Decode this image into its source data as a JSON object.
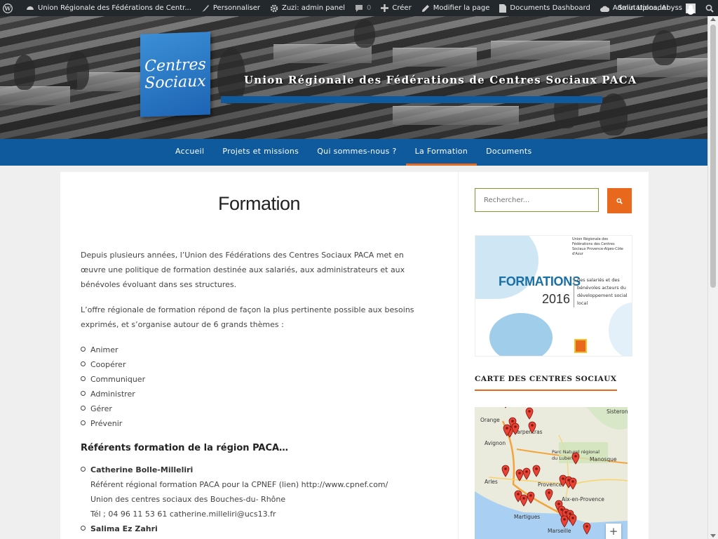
{
  "admin_bar": {
    "items": [
      {
        "name": "site-link",
        "label": "Union Régionale des Fédérations de Centr..."
      },
      {
        "name": "customize-link",
        "label": "Personnaliser"
      },
      {
        "name": "admin-panel-link",
        "label": "Zuzi: admin panel"
      },
      {
        "name": "comments-link",
        "label": "0"
      },
      {
        "name": "new-content-link",
        "label": "Créer"
      },
      {
        "name": "edit-page-link",
        "label": "Modifier la page"
      },
      {
        "name": "documents-dashboard-link",
        "label": "Documents Dashboard"
      },
      {
        "name": "admin-uploader-link",
        "label": "Admin Uploader"
      }
    ],
    "greeting": "Salutations, Abyss"
  },
  "header": {
    "logo_text": "Centres Sociaux",
    "site_title": "Union Régionale des Fédérations de Centres Sociaux PACA"
  },
  "nav": {
    "items": [
      "Accueil",
      "Projets et missions",
      "Qui sommes-nous ?",
      "La Formation",
      "Documents"
    ],
    "active": "La Formation"
  },
  "main": {
    "title": "Formation",
    "intro": "Depuis plusieurs années, l’Union des Fédérations des Centres Sociaux PACA met en œuvre une politique de formation destinée aux salariés, aux administrateurs et aux bénévoles évoluant dans ses structures.",
    "intro2": "L’offre régionale de formation répond de façon la plus pertinente possible aux besoins exprimés, et s’organise autour de 6 grands thèmes :",
    "themes": [
      "Animer",
      "Coopérer",
      "Communiquer",
      "Administrer",
      "Gérer",
      "Prévenir"
    ],
    "referents_heading": "Référents formation de la région PACA…",
    "referents": [
      {
        "name": "Catherine Bolle-Milleliri",
        "line1": "Référent régional formation PACA pour la CPNEF (lien) http://www.cpnef.com/",
        "line2": "Union des centres sociaux des Bouches-du- Rhône",
        "line3": "Tél ; 04 96 11 53 61 catherine.milleliri@ucs13.fr"
      },
      {
        "name": "Salima Ez Zahri"
      }
    ]
  },
  "sidebar": {
    "search_placeholder": "Rechercher...",
    "promo": {
      "org": "Union Régionale des Fédérations des Centres Sociaux Provence-Alpes-Côte d'Azur",
      "big": "FORMATIONS",
      "year": "2016",
      "desc": "des salariés et des bénévoles acteurs du développement social local"
    },
    "map_title": "CARTE DES CENTRES SOCIAUX",
    "map_labels": [
      "Orange",
      "Sisteron",
      "Carpentras",
      "Avignon",
      "Parc Naturel régional du Luberon",
      "Manosque",
      "Arles",
      "Provence",
      "Aix-en-Provence",
      "Martigues",
      "Marseille"
    ]
  },
  "colors": {
    "primary": "#0e5a9c",
    "accent": "#e8691e",
    "admin_bar": "#23282d"
  }
}
